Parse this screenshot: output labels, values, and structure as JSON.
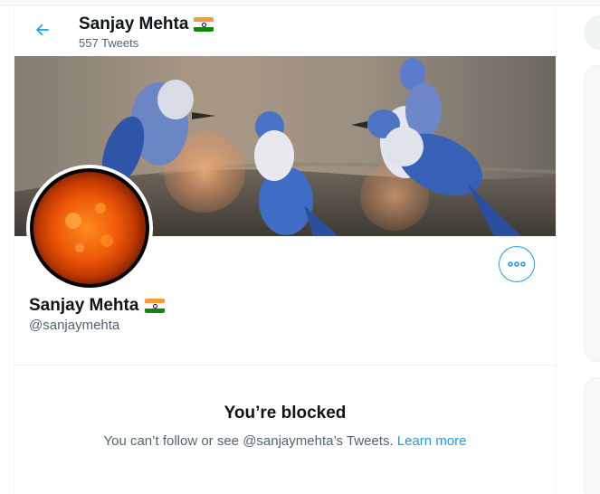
{
  "profile": {
    "name": "Sanjay Mehta",
    "tweet_count": "557 Tweets",
    "handle": "@sanjaymehta",
    "flag_icon": "india-flag-icon"
  },
  "blocked": {
    "title": "You’re blocked",
    "message": "You can’t follow or see @sanjaymehta’s Tweets. ",
    "link": "Learn more"
  },
  "colors": {
    "accent": "#1d9bf0",
    "text": "#0f1419",
    "secondary_text": "#536471",
    "border": "#eff3f4"
  },
  "icons": {
    "back": "back-arrow-icon",
    "more": "more-options-icon",
    "banner": "blue-jays-banner-image",
    "avatar": "sun-avatar-image"
  }
}
